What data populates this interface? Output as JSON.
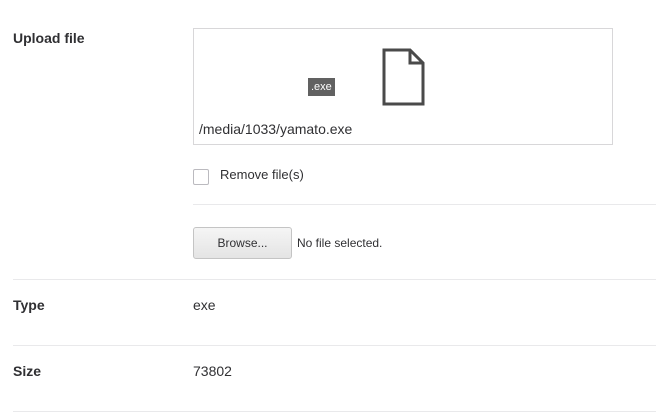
{
  "upload": {
    "label": "Upload file",
    "extension_badge": ".exe",
    "file_icon": "document-icon",
    "file_path": "/media/1033/yamato.exe",
    "remove_label": "Remove file(s)",
    "remove_checked": false,
    "browse_label": "Browse...",
    "file_status": "No file selected."
  },
  "fields": {
    "type_label": "Type",
    "type_value": "exe",
    "size_label": "Size",
    "size_value": "73802"
  }
}
